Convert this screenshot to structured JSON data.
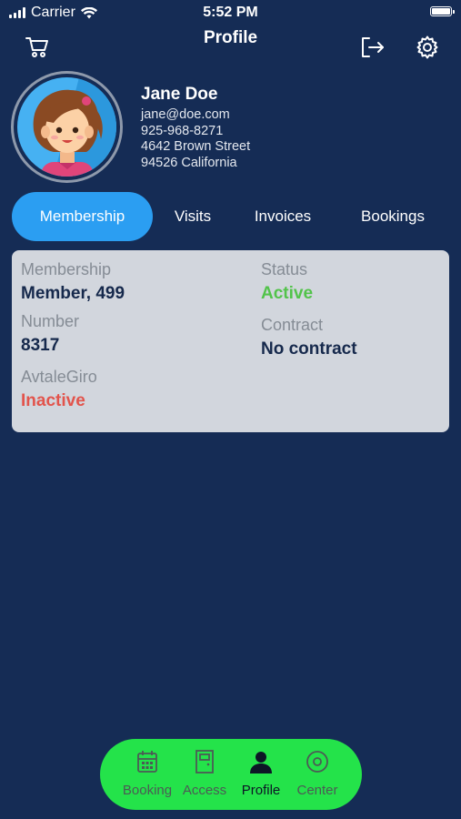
{
  "status_bar": {
    "carrier": "Carrier",
    "time": "5:52 PM"
  },
  "nav": {
    "title": "Profile",
    "icons": [
      "cart-icon",
      "logout-icon",
      "gear-icon"
    ]
  },
  "profile": {
    "name": "Jane Doe",
    "email": "jane@doe.com",
    "phone": "925-968-8271",
    "street": "4642 Brown Street",
    "city": "94526 California"
  },
  "tabs": [
    {
      "label": "Membership",
      "active": true
    },
    {
      "label": "Visits",
      "active": false
    },
    {
      "label": "Invoices",
      "active": false
    },
    {
      "label": "Bookings",
      "active": false
    }
  ],
  "membership": {
    "membership_label": "Membership",
    "membership_value": "Member, 499",
    "number_label": "Number",
    "number_value": "8317",
    "avtalegiro_label": "AvtaleGiro",
    "avtalegiro_value": "Inactive",
    "status_label": "Status",
    "status_value": "Active",
    "contract_label": "Contract",
    "contract_value": "No contract"
  },
  "bottom_nav": [
    {
      "label": "Booking",
      "icon": "calendar-icon",
      "active": false
    },
    {
      "label": "Access",
      "icon": "door-icon",
      "active": false
    },
    {
      "label": "Profile",
      "icon": "person-icon",
      "active": true
    },
    {
      "label": "Center",
      "icon": "target-icon",
      "active": false
    }
  ],
  "colors": {
    "background": "#152c55",
    "tab_active": "#2b9ef2",
    "card": "#d2d6dd",
    "status_active": "#52c34a",
    "status_inactive": "#e2544c",
    "bottom_nav": "#24e34a"
  }
}
